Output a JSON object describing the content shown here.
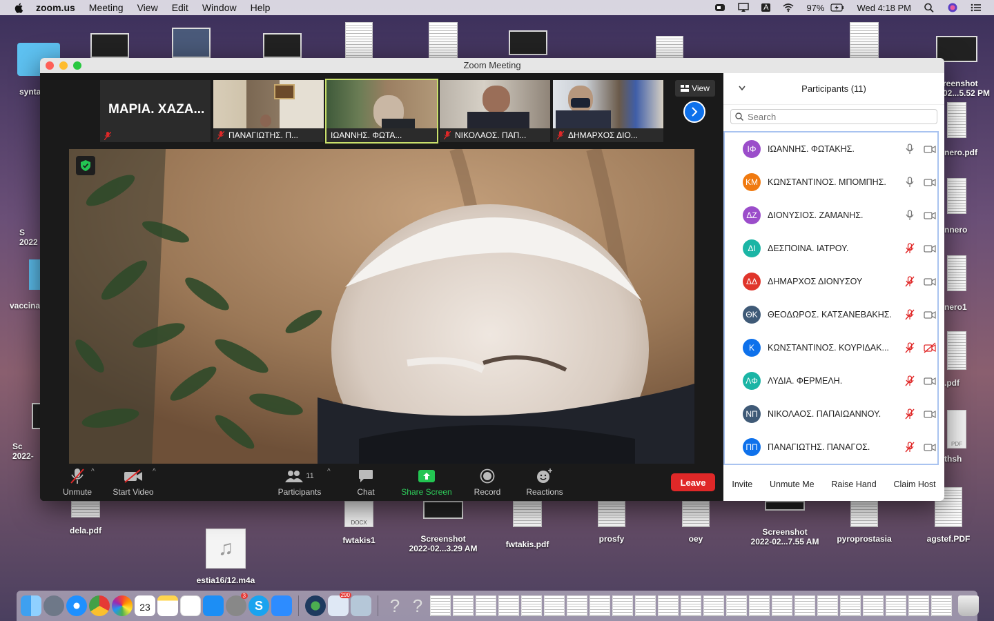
{
  "menubar": {
    "app": "zoom.us",
    "items": [
      "Meeting",
      "View",
      "Edit",
      "Window",
      "Help"
    ],
    "battery": "97%",
    "clock": "Wed 4:18 PM",
    "input_source": "A"
  },
  "desktop": {
    "files": [
      {
        "label": "synta",
        "kind": "folder"
      },
      {
        "label": "S 2022",
        "kind": "text"
      },
      {
        "label": "vaccina",
        "kind": "folder"
      },
      {
        "label": "Sc 2022-",
        "kind": "text"
      },
      {
        "label": "dela.pdf",
        "kind": "doc"
      },
      {
        "label": "estia16/12.m4a",
        "kind": "audio"
      },
      {
        "label": "fwtakis1",
        "kind": "doc",
        "badge": "DOCX"
      },
      {
        "label": "Screenshot",
        "sub": "2022-02...3.29 AM",
        "kind": "shot"
      },
      {
        "label": "fwtakis.pdf",
        "kind": "doc"
      },
      {
        "label": "prosfy",
        "kind": "doc"
      },
      {
        "label": "oey",
        "kind": "doc"
      },
      {
        "label": "Screenshot",
        "sub": "2022-02...7.55 AM",
        "kind": "shot"
      },
      {
        "label": "pyroprostasia",
        "kind": "doc"
      },
      {
        "label": "agstef.PDF",
        "kind": "doc"
      },
      {
        "label": "reenshot",
        "sub": "02...5.52 PM",
        "kind": "shot"
      },
      {
        "label": "nero.pdf",
        "kind": "doc"
      },
      {
        "label": "nnero",
        "kind": "doc"
      },
      {
        "label": "nero1",
        "kind": "doc"
      },
      {
        "label": ".pdf",
        "kind": "doc"
      },
      {
        "label": "thsh",
        "kind": "doc",
        "badge": "PDF"
      }
    ]
  },
  "window": {
    "title": "Zoom Meeting"
  },
  "gallery": {
    "tiles": [
      {
        "name": "ΜΑΡΙΑ. ΧΑΖΑ...",
        "muted": true,
        "video": false,
        "active": false
      },
      {
        "name": "ΠΑΝΑΓΙΩΤΗΣ. Π...",
        "muted": true,
        "video": true,
        "active": false
      },
      {
        "name": "ΙΩΑΝΝΗΣ. ΦΩΤΑ...",
        "muted": false,
        "video": true,
        "active": true
      },
      {
        "name": "ΝΙΚΟΛΑΟΣ. ΠΑΠ...",
        "muted": true,
        "video": true,
        "active": false
      },
      {
        "name": "ΔΗΜΑΡΧΟΣ ΔΙΟ...",
        "muted": true,
        "video": true,
        "active": false
      }
    ],
    "view_label": "View"
  },
  "toolbar": {
    "unmute": "Unmute",
    "start_video": "Start Video",
    "participants": "Participants",
    "participants_count": "11",
    "chat": "Chat",
    "share_screen": "Share Screen",
    "record": "Record",
    "reactions": "Reactions",
    "leave": "Leave"
  },
  "panel": {
    "title": "Participants (11)",
    "search_placeholder": "Search",
    "participants": [
      {
        "initials": "ΙΦ",
        "name": "ΙΩΑΝΝΗΣ. ΦΩΤΑΚΗΣ.",
        "color": "#9b4dca",
        "mic": "on",
        "video": "off"
      },
      {
        "initials": "ΚΜ",
        "name": "ΚΩΝΣΤΑΝΤΙΝΟΣ. ΜΠΟΜΠΗΣ.",
        "color": "#f07a10",
        "mic": "on",
        "video": "off"
      },
      {
        "initials": "ΔΖ",
        "name": "ΔΙΟΝΥΣΙΟΣ. ΖΑΜΑΝΗΣ.",
        "color": "#9b4dca",
        "mic": "on",
        "video": "off"
      },
      {
        "initials": "ΔΙ",
        "name": "ΔΕΣΠΟΙΝΑ. ΙΑΤΡΟΥ.",
        "color": "#1bb5a5",
        "mic": "muted",
        "video": "off"
      },
      {
        "initials": "ΔΔ",
        "name": "ΔΗΜΑΡΧΟΣ ΔΙΟΝΥΣΟΥ",
        "color": "#e0352b",
        "mic": "muted",
        "video": "off"
      },
      {
        "initials": "ΘΚ",
        "name": "ΘΕΟΔΩΡΟΣ. ΚΑΤΣΑΝΕΒΑΚΗΣ.",
        "color": "#3f5a77",
        "mic": "muted",
        "video": "off"
      },
      {
        "initials": "Κ",
        "name": "ΚΩΝΣΤΑΝΤΙΝΟΣ. ΚΟΥΡΙΔΑΚ...",
        "color": "#0e71eb",
        "mic": "muted",
        "video": "blocked"
      },
      {
        "initials": "ΛΦ",
        "name": "ΛΥΔΙΑ. ΦΕΡΜΕΛΗ.",
        "color": "#1bb5a5",
        "mic": "muted",
        "video": "off"
      },
      {
        "initials": "ΝΠ",
        "name": "ΝΙΚΟΛΑΟΣ. ΠΑΠΑΙΩΑΝΝΟΥ.",
        "color": "#3f5a77",
        "mic": "muted",
        "video": "off"
      },
      {
        "initials": "ΠΠ",
        "name": "ΠΑΝΑΓΙΩΤΗΣ. ΠΑΝΑΓΟΣ.",
        "color": "#0e71eb",
        "mic": "muted",
        "video": "off"
      }
    ],
    "actions": [
      "Invite",
      "Unmute Me",
      "Raise Hand",
      "Claim Host"
    ]
  },
  "dock": {
    "calendar_day": "23",
    "mail_badge": "290",
    "other_badge": "3"
  }
}
